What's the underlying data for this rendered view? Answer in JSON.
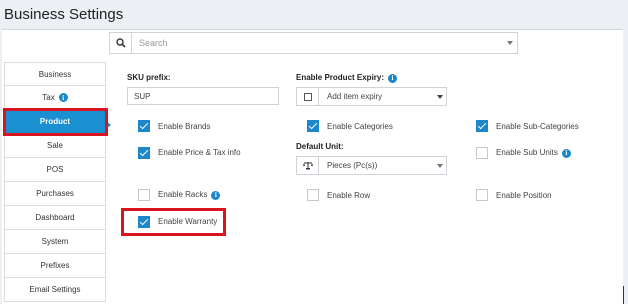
{
  "page": {
    "title": "Business Settings"
  },
  "search": {
    "placeholder": "Search"
  },
  "nav": {
    "items": [
      {
        "label": "Business",
        "active": false,
        "info": false
      },
      {
        "label": "Tax",
        "active": false,
        "info": true
      },
      {
        "label": "Product",
        "active": true,
        "info": false
      },
      {
        "label": "Sale",
        "active": false,
        "info": false
      },
      {
        "label": "POS",
        "active": false,
        "info": false
      },
      {
        "label": "Purchases",
        "active": false,
        "info": false
      },
      {
        "label": "Dashboard",
        "active": false,
        "info": false
      },
      {
        "label": "System",
        "active": false,
        "info": false
      },
      {
        "label": "Prefixes",
        "active": false,
        "info": false
      },
      {
        "label": "Email Settings",
        "active": false,
        "info": false
      }
    ]
  },
  "product": {
    "sku_prefix_label": "SKU prefix:",
    "sku_prefix_value": "SUP",
    "expiry_label": "Enable Product Expiry:",
    "expiry_select_value": "Add item expiry",
    "expiry_checked": false,
    "default_unit_label": "Default Unit:",
    "default_unit_value": "Pieces (Pc(s))",
    "checkboxes": {
      "brands": {
        "label": "Enable Brands",
        "checked": true
      },
      "categories": {
        "label": "Enable Categories",
        "checked": true
      },
      "sub_categories": {
        "label": "Enable Sub-Categories",
        "checked": true
      },
      "price_tax": {
        "label": "Enable Price & Tax info",
        "checked": true
      },
      "sub_units": {
        "label": "Enable Sub Units",
        "checked": false
      },
      "racks": {
        "label": "Enable Racks",
        "checked": false
      },
      "row": {
        "label": "Enable Row",
        "checked": false
      },
      "position": {
        "label": "Enable Position",
        "checked": false
      },
      "warranty": {
        "label": "Enable Warranty",
        "checked": true
      }
    }
  },
  "colors": {
    "accent": "#1a8fd1",
    "highlight": "#d9141e"
  }
}
